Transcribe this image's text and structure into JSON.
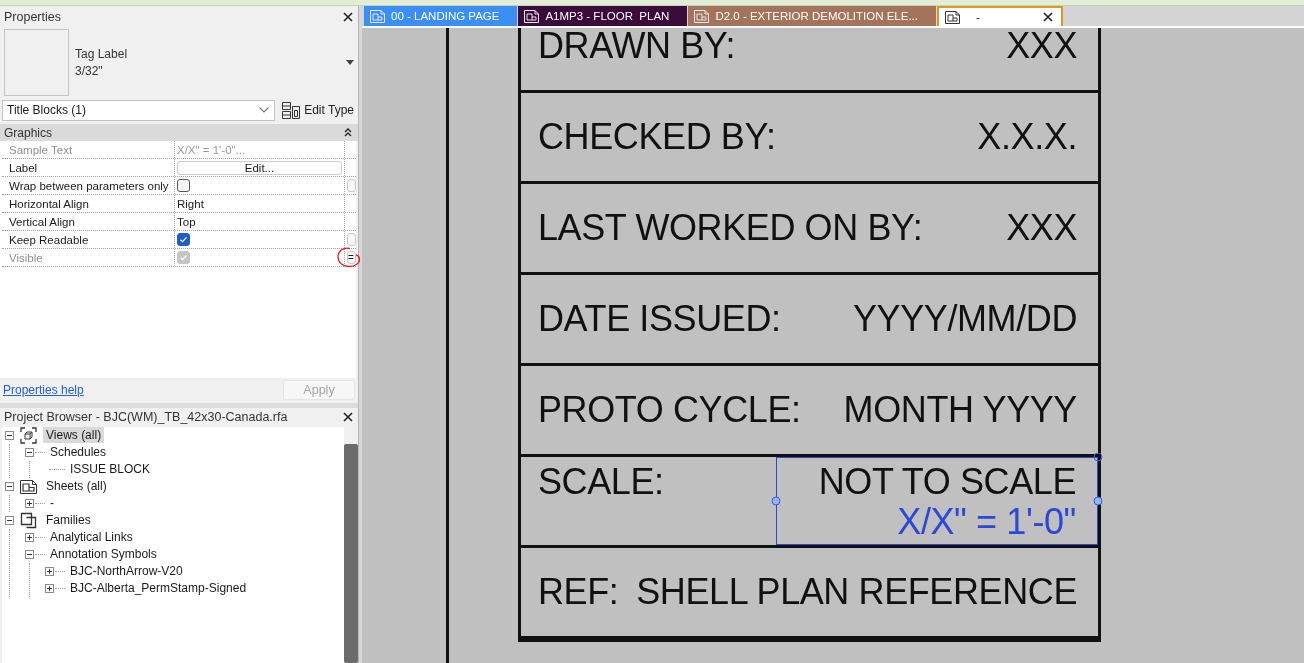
{
  "properties": {
    "title": "Properties",
    "type": {
      "name": "Tag Label",
      "size": "3/32\""
    },
    "filter": {
      "value": "Title Blocks (1)"
    },
    "edit_type": "Edit Type",
    "section": {
      "title": "Graphics",
      "expanded": true
    },
    "rows": [
      {
        "kind": "text",
        "name": "Sample Text",
        "value": "X/X\" = 1'-0\"...",
        "disabled": true,
        "param_button": false,
        "annotated": false
      },
      {
        "kind": "button",
        "name": "Label",
        "value": "Edit...",
        "disabled": false,
        "param_button": false,
        "annotated": false
      },
      {
        "kind": "checkbox",
        "name": "Wrap between parameters only",
        "checked": false,
        "disabled": false,
        "param_button": true,
        "annotated": false
      },
      {
        "kind": "text",
        "name": "Horizontal Align",
        "value": "Right",
        "disabled": false,
        "param_button": false,
        "annotated": false
      },
      {
        "kind": "text",
        "name": "Vertical Align",
        "value": "Top",
        "disabled": false,
        "param_button": false,
        "annotated": false
      },
      {
        "kind": "checkbox",
        "name": "Keep Readable",
        "checked": true,
        "disabled": false,
        "param_button": true,
        "annotated": false
      },
      {
        "kind": "checkbox",
        "name": "Visible",
        "checked": true,
        "disabled": true,
        "param_button": true,
        "param_label": "=",
        "annotated": true
      }
    ],
    "help": "Properties help",
    "apply": {
      "label": "Apply",
      "disabled": true
    }
  },
  "project_browser": {
    "title": "Project Browser - BJC(WM)_TB_42x30-Canada.rfa",
    "tree": [
      {
        "label": "Views (all)",
        "expanded": true,
        "selected": true,
        "children": [
          {
            "label": "Schedules",
            "expanded": true,
            "selected": false,
            "children": [
              {
                "label": "ISSUE BLOCK",
                "selected": false
              }
            ]
          }
        ]
      },
      {
        "label": "Sheets (all)",
        "expanded": true,
        "selected": false,
        "children": [
          {
            "label": "-",
            "expanded": false,
            "selected": false
          }
        ]
      },
      {
        "label": "Families",
        "expanded": true,
        "selected": false,
        "children": [
          {
            "label": "Analytical Links",
            "expanded": false,
            "selected": false
          },
          {
            "label": "Annotation Symbols",
            "expanded": true,
            "selected": false,
            "children": [
              {
                "label": "BJC-NorthArrow-V20",
                "expanded": false,
                "selected": false
              },
              {
                "label": "BJC-Alberta_PermStamp-Signed",
                "expanded": false,
                "selected": false
              }
            ]
          }
        ]
      }
    ]
  },
  "tabs": [
    {
      "label": "00 - LANDING PAGE",
      "selected": false,
      "color": "#3a8ef4"
    },
    {
      "label": "A1MP3 - FLOOR  PLAN",
      "selected": false,
      "color": "#3b0b3b"
    },
    {
      "label": "D2.0 - EXTERIOR DEMOLITION ELE...",
      "selected": false,
      "color": "#a3735a"
    },
    {
      "label": "-",
      "selected": true,
      "color": "#e3951e"
    }
  ],
  "title_block": {
    "rows": [
      {
        "label": "DRAWN BY:",
        "value": "XXX"
      },
      {
        "label": "CHECKED BY:",
        "value": "X.X.X."
      },
      {
        "label": "LAST WORKED ON BY:",
        "value": "XXX"
      },
      {
        "label": "DATE ISSUED:",
        "value": "YYYY/MM/DD"
      },
      {
        "label": "PROTO CYCLE:",
        "value": "MONTH YYYY"
      },
      {
        "label": "SCALE:",
        "value": "NOT TO SCALE",
        "tag_label": {
          "text": "X/X\" = 1'-0\"",
          "selected": true
        }
      },
      {
        "label": "REF:",
        "value": "SHELL PLAN REFERENCE"
      }
    ]
  }
}
